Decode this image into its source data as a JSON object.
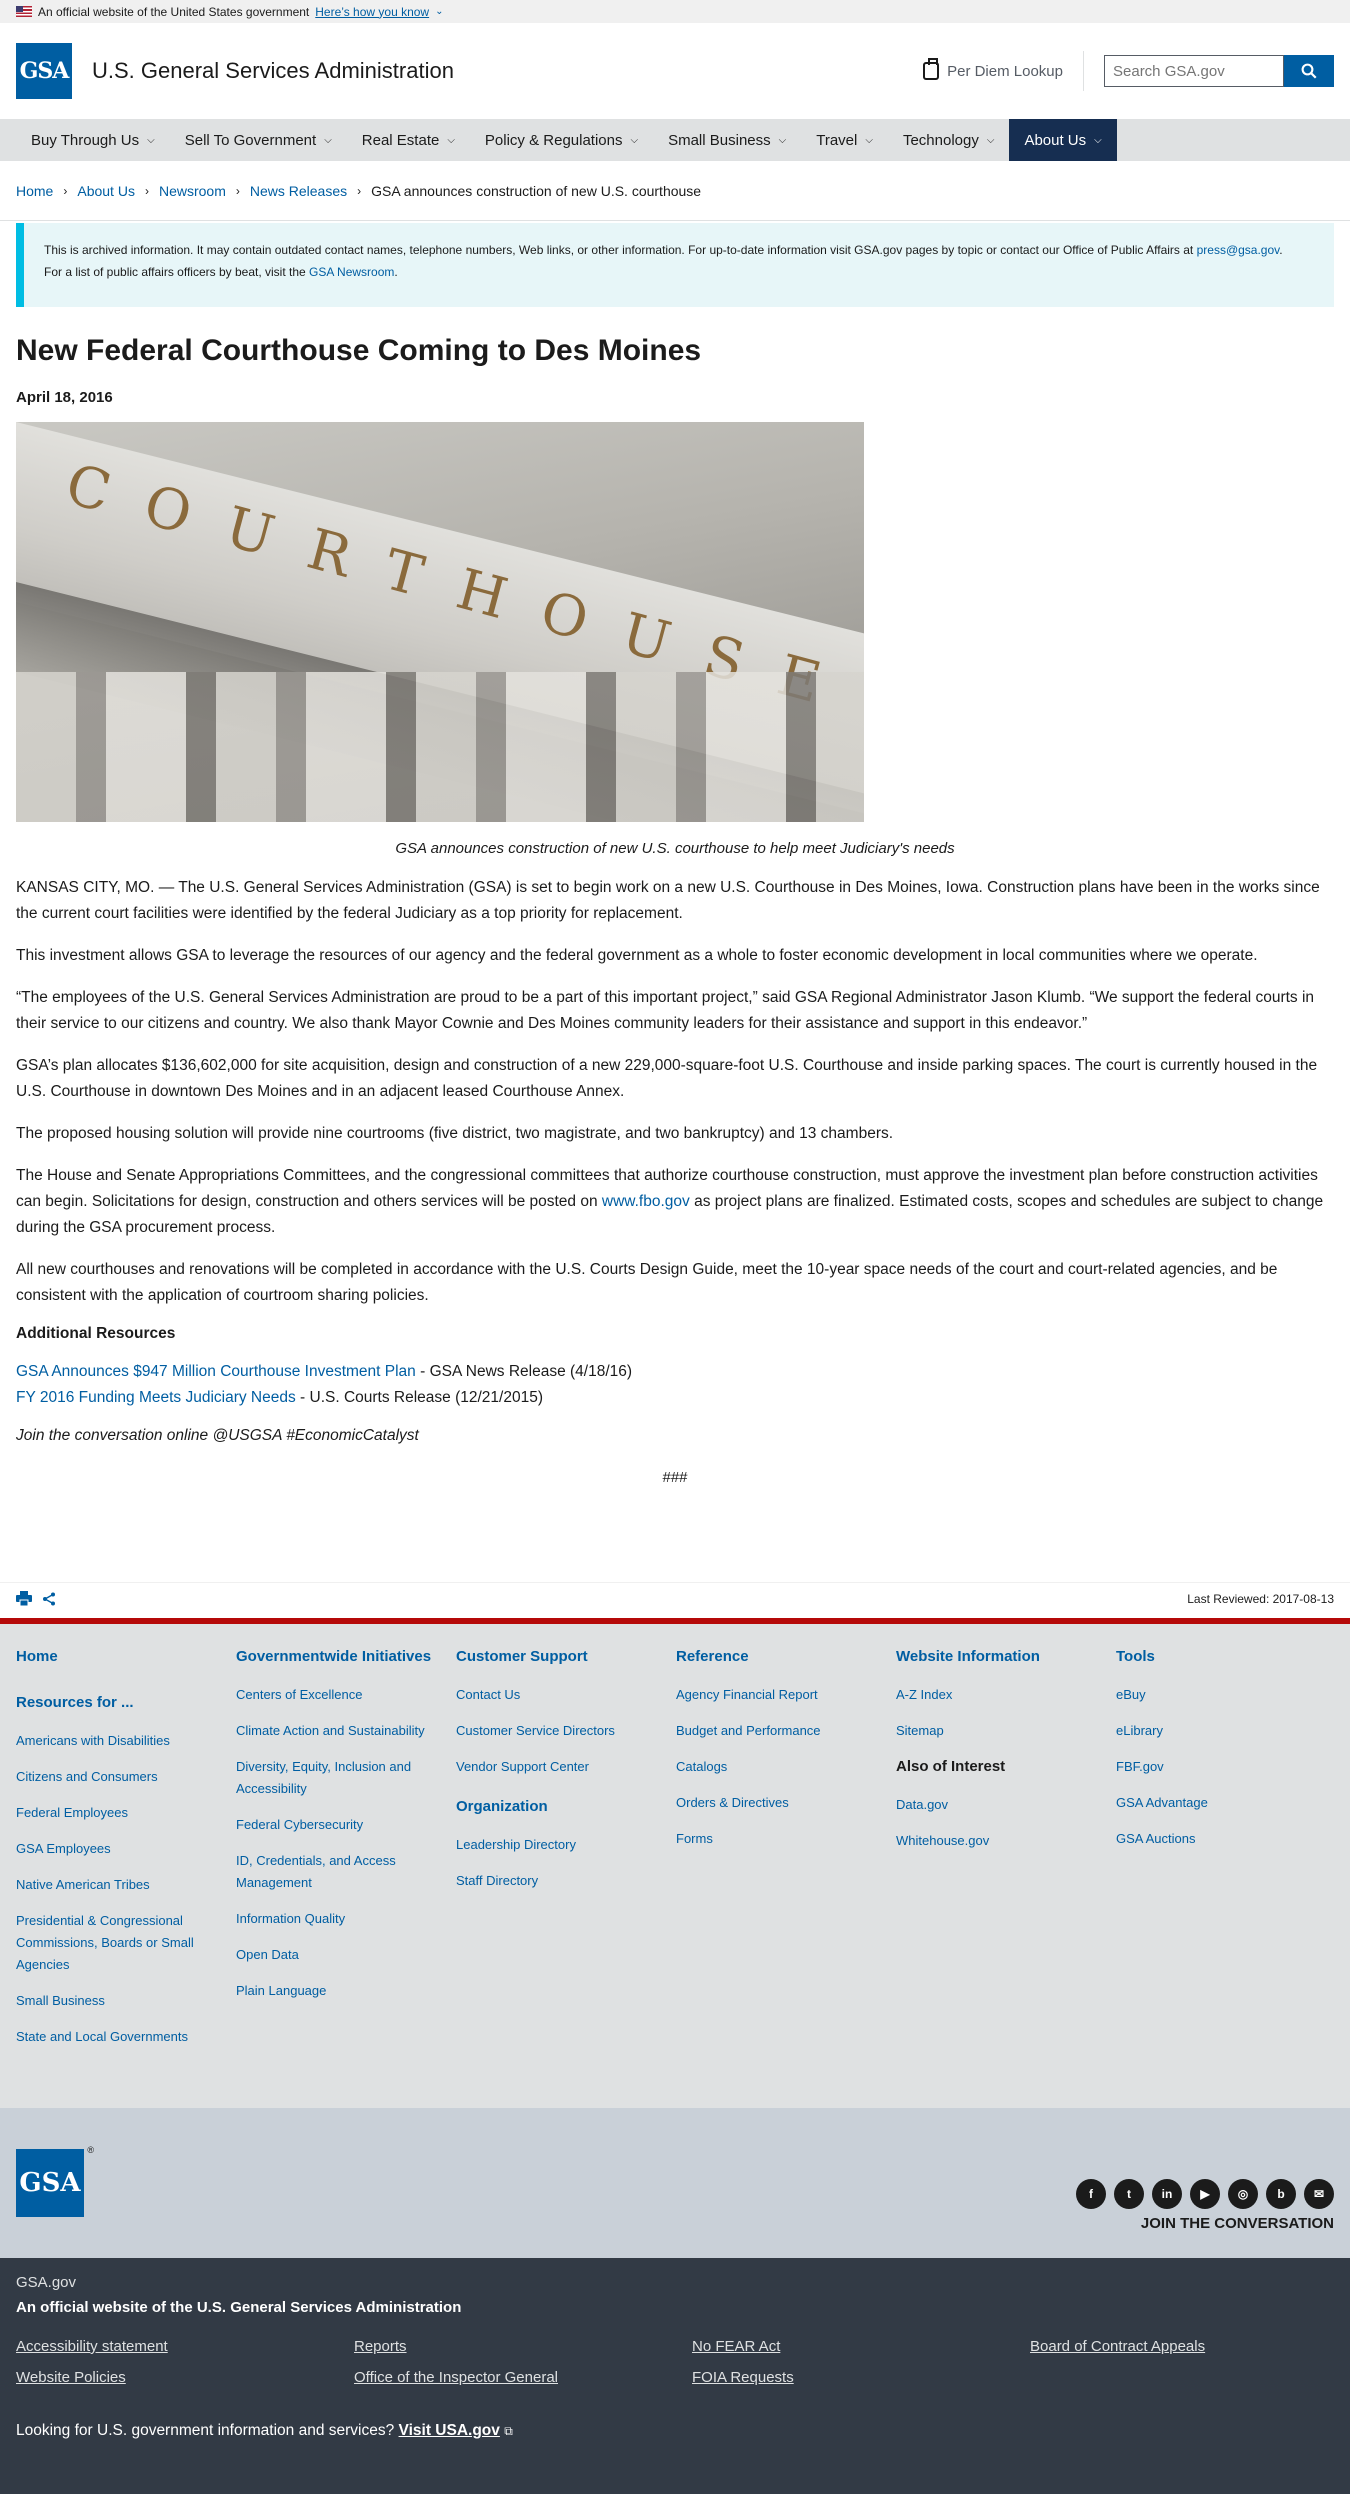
{
  "gov_banner": {
    "text": "An official website of the United States government",
    "link": "Here’s how you know"
  },
  "header": {
    "logo": "GSA",
    "agency": "U.S. General Services Administration",
    "per_diem": "Per Diem Lookup",
    "search_placeholder": "Search GSA.gov"
  },
  "nav": [
    "Buy Through Us",
    "Sell To Government",
    "Real Estate",
    "Policy & Regulations",
    "Small Business",
    "Travel",
    "Technology",
    "About Us"
  ],
  "breadcrumb": [
    "Home",
    "About Us",
    "Newsroom",
    "News Releases",
    "GSA announces construction of new U.S. courthouse"
  ],
  "alert": {
    "line1_pre": "This is archived information. It may contain outdated contact names, telephone numbers, Web links, or other information. For up-to-date information visit GSA.gov pages by topic or contact our Office of Public Affairs at",
    "email": "press@gsa.gov",
    "line2_pre": "For a list of public affairs officers by beat, visit the",
    "newsroom": "GSA Newsroom"
  },
  "article": {
    "title": "New Federal Courthouse Coming to Des Moines",
    "date": "April 18, 2016",
    "image_text": "COURTHOUSE",
    "caption": "GSA announces construction of new U.S. courthouse to help meet Judiciary's needs",
    "p1": "KANSAS CITY, MO. — The U.S. General Services Administration (GSA) is set to begin work on a new U.S. Courthouse in Des Moines, Iowa. Construction plans have been in the works since the current court facilities were identified by the federal Judiciary as a top priority for replacement.",
    "p2": "This investment allows GSA to leverage the resources of our agency and the federal government as a whole to foster economic development in local communities where we operate.",
    "p3": "“The employees of the U.S. General Services Administration are proud to be a part of this important project,” said GSA Regional Administrator Jason Klumb. “We support the federal courts in their service to our citizens and country. We also thank Mayor Cownie and Des Moines community leaders for their assistance and support in this endeavor.”",
    "p4": "GSA’s plan allocates $136,602,000 for site acquisition, design and construction of a new 229,000-square-foot U.S. Courthouse and inside parking spaces. The court is currently housed in the U.S. Courthouse in downtown Des Moines and in an adjacent leased Courthouse Annex.",
    "p5": "The proposed housing solution will provide nine courtrooms (five district, two magistrate, and two bankruptcy) and 13 chambers.",
    "p6_pre": "The House and Senate Appropriations Committees, and the congressional committees that authorize courthouse construction, must approve the investment plan before construction activities can begin. Solicitations for design, construction and others services will be posted on",
    "p6_link": "www.fbo.gov",
    "p6_post": "as project plans are finalized. Estimated costs, scopes and schedules are subject to change during the GSA procurement process.",
    "p7": "All new courthouses and renovations will be completed in accordance with the U.S. Courts Design Guide, meet the 10-year space needs of the court and court-related agencies, and be consistent with the application of courtroom sharing policies.",
    "resources_heading": "Additional Resources",
    "resources": [
      {
        "link": "GSA Announces $947 Million Courthouse Investment Plan",
        "suffix": " - GSA News Release (4/18/16)"
      },
      {
        "link": "FY 2016 Funding Meets Judiciary Needs",
        "suffix": " - U.S. Courts Release (12/21/2015)"
      }
    ],
    "conversation": "Join the conversation online @USGSA #EconomicCatalyst",
    "end_mark": "###"
  },
  "last_reviewed": "Last Reviewed: 2017-08-13",
  "footer": {
    "col1": {
      "heading": "Home",
      "sub": "Resources for ...",
      "links": [
        "Americans with Disabilities",
        "Citizens and Consumers",
        "Federal Employees",
        "GSA Employees",
        "Native American Tribes",
        "Presidential & Congressional Commissions, Boards or Small Agencies",
        "Small Business",
        "State and Local Governments"
      ]
    },
    "col2": {
      "heading": "Governmentwide Initiatives",
      "links": [
        "Centers of Excellence",
        "Climate Action and Sustainability",
        "Diversity, Equity, Inclusion and Accessibility",
        "Federal Cybersecurity",
        "ID, Credentials, and Access Management",
        "Information Quality",
        "Open Data",
        "Plain Language"
      ]
    },
    "col3": {
      "heading": "Customer Support",
      "links": [
        "Contact Us",
        "Customer Service Directors",
        "Vendor Support Center"
      ],
      "heading2": "Organization",
      "links2": [
        "Leadership Directory",
        "Staff Directory"
      ]
    },
    "col4": {
      "heading": "Reference",
      "links": [
        "Agency Financial Report",
        "Budget and Performance",
        "Catalogs",
        "Orders & Directives",
        "Forms"
      ]
    },
    "col5": {
      "heading": "Website Information",
      "links": [
        "A-Z Index",
        "Sitemap"
      ],
      "heading2": "Also of Interest",
      "links2": [
        "Data.gov",
        "Whitehouse.gov"
      ]
    },
    "col6": {
      "heading": "Tools",
      "links": [
        "eBuy",
        "eLibrary",
        "FBF.gov",
        "GSA Advantage",
        "GSA Auctions"
      ]
    }
  },
  "footer_logo": "GSA",
  "social": {
    "icons": [
      "facebook-icon",
      "twitter-icon",
      "linkedin-icon",
      "youtube-icon",
      "instagram-icon",
      "blog-icon",
      "email-icon"
    ],
    "join": "JOIN THE CONVERSATION"
  },
  "identifier": {
    "domain": "GSA.gov",
    "official": "An official website of the U.S. General Services Administration",
    "links": [
      "Accessibility statement",
      "Reports",
      "No FEAR Act",
      "Board of Contract Appeals",
      "Website Policies",
      "Office of the Inspector General",
      "FOIA Requests"
    ],
    "usa_pre": "Looking for U.S. government information and services?",
    "usa_link": "Visit USA.gov"
  }
}
